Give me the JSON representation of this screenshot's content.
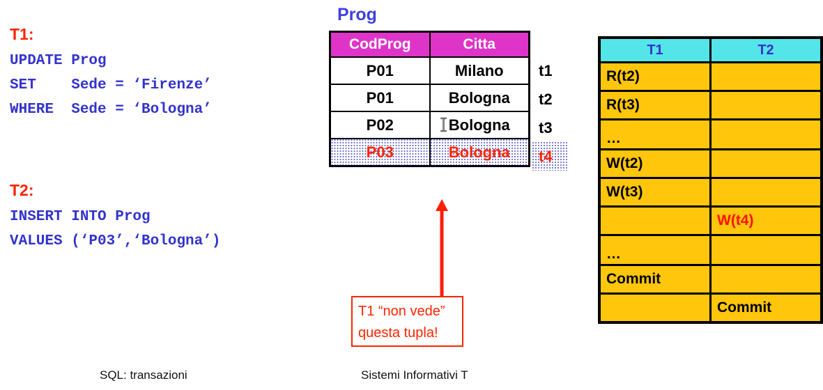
{
  "slide": {
    "title_hint": "SQL transactions - phantom row example"
  },
  "transactions": [
    {
      "id": "t1-block",
      "label": "T1:",
      "lines": [
        "UPDATE Prog",
        "SET    Sede = ‘Firenze’",
        "WHERE  Sede = ‘Bologna’"
      ]
    },
    {
      "id": "t2-block",
      "label": "T2:",
      "lines": [
        "INSERT INTO Prog",
        "VALUES (‘P03’,‘Bologna’)"
      ]
    }
  ],
  "prog_table": {
    "title": "Prog",
    "columns": [
      "CodProg",
      "Citta"
    ],
    "rows": [
      {
        "cells": [
          "P01",
          "Milano"
        ],
        "tuple": "t1",
        "highlighted": false
      },
      {
        "cells": [
          "P01",
          "Bologna"
        ],
        "tuple": "t2",
        "highlighted": false
      },
      {
        "cells": [
          "P02",
          "Bologna"
        ],
        "tuple": "t3",
        "highlighted": false
      },
      {
        "cells": [
          "P03",
          "Bologna"
        ],
        "tuple": "t4",
        "highlighted": true
      }
    ],
    "header_color": "#DE35C8",
    "header_text_color": "#FFFFFF",
    "highlight_text_color": "#FF2400",
    "title_color": "#4040DD"
  },
  "callout": {
    "lines": [
      "T1 “non vede”",
      "questa tupla!"
    ],
    "color": "#FF2400"
  },
  "schedule_table": {
    "columns": [
      "T1",
      "T2"
    ],
    "header_bg": "#54E5E8",
    "header_text_color": "#3333CC",
    "body_bg": "#FFC60B",
    "rows": [
      {
        "t1": "R(t2)",
        "t2": "",
        "t1_red": false,
        "t2_red": false
      },
      {
        "t1": "R(t3)",
        "t2": "",
        "t1_red": false,
        "t2_red": false
      },
      {
        "t1": "…",
        "t2": "",
        "t1_red": false,
        "t2_red": false
      },
      {
        "t1": "W(t2)",
        "t2": "",
        "t1_red": false,
        "t2_red": false
      },
      {
        "t1": "W(t3)",
        "t2": "",
        "t1_red": false,
        "t2_red": false
      },
      {
        "t1": "",
        "t2": "W(t4)",
        "t1_red": false,
        "t2_red": true
      },
      {
        "t1": "…",
        "t2": "",
        "t1_red": false,
        "t2_red": false
      },
      {
        "t1": "Commit",
        "t2": "",
        "t1_red": false,
        "t2_red": false
      },
      {
        "t1": "",
        "t2": "Commit",
        "t1_red": false,
        "t2_red": false
      }
    ]
  },
  "footer": {
    "left": "SQL: transazioni",
    "right": "Sistemi Informativi T"
  }
}
